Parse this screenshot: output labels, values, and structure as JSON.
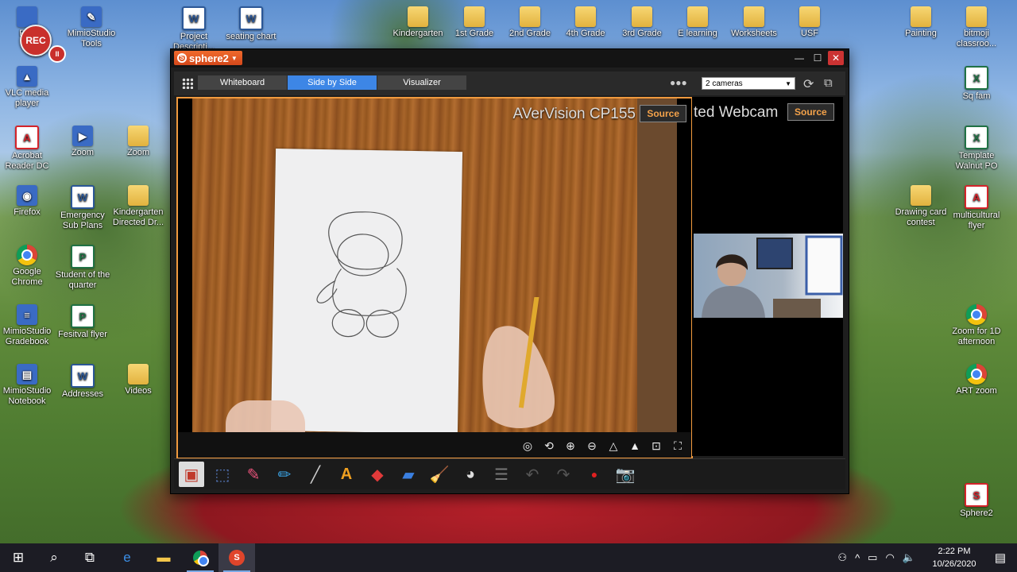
{
  "recorder": {
    "label": "REC"
  },
  "desktop_icons": [
    {
      "label": "Rec",
      "kind": "appbox",
      "glyph": ""
    },
    {
      "label": "MimioStudio Tools",
      "kind": "appbox",
      "glyph": "✎"
    },
    {
      "label": "Project Descripti...",
      "kind": "word",
      "glyph": "W"
    },
    {
      "label": "seating chart",
      "kind": "word",
      "glyph": "W"
    },
    {
      "label": "Kindergarten",
      "kind": "folder",
      "glyph": ""
    },
    {
      "label": "1st Grade",
      "kind": "folder",
      "glyph": ""
    },
    {
      "label": "2nd Grade",
      "kind": "folder",
      "glyph": ""
    },
    {
      "label": "4th Grade",
      "kind": "folder",
      "glyph": ""
    },
    {
      "label": "3rd Grade",
      "kind": "folder",
      "glyph": ""
    },
    {
      "label": "E learning",
      "kind": "folder",
      "glyph": ""
    },
    {
      "label": "Worksheets",
      "kind": "folder",
      "glyph": ""
    },
    {
      "label": "USF",
      "kind": "folder",
      "glyph": ""
    },
    {
      "label": "Painting",
      "kind": "folder",
      "glyph": ""
    },
    {
      "label": "bitmoji classroo...",
      "kind": "folder",
      "glyph": ""
    },
    {
      "label": "VLC media player",
      "kind": "appbox",
      "glyph": "▲"
    },
    {
      "label": "Sq fam",
      "kind": "excel",
      "glyph": "X"
    },
    {
      "label": "Acrobat Reader DC",
      "kind": "pdf",
      "glyph": "A"
    },
    {
      "label": "Zoom",
      "kind": "appbox",
      "glyph": "▶"
    },
    {
      "label": "Zoom",
      "kind": "folder",
      "glyph": ""
    },
    {
      "label": "Template Walnut PO",
      "kind": "excel",
      "glyph": "X"
    },
    {
      "label": "Firefox",
      "kind": "appbox",
      "glyph": "◉"
    },
    {
      "label": "Emergency Sub Plans",
      "kind": "word",
      "glyph": "W"
    },
    {
      "label": "Kindergarten Directed Dr...",
      "kind": "folder",
      "glyph": ""
    },
    {
      "label": "Drawing card contest",
      "kind": "folder",
      "glyph": ""
    },
    {
      "label": "multicultural flyer",
      "kind": "pdf",
      "glyph": "A"
    },
    {
      "label": "Google Chrome",
      "kind": "chrome",
      "glyph": ""
    },
    {
      "label": "Student of the quarter",
      "kind": "excel",
      "glyph": "P"
    },
    {
      "label": "MimioStudio Gradebook",
      "kind": "appbox",
      "glyph": "≡"
    },
    {
      "label": "Fesitval flyer",
      "kind": "excel",
      "glyph": "P"
    },
    {
      "label": "Zoom for 1D afternoon",
      "kind": "chrome",
      "glyph": ""
    },
    {
      "label": "MimioStudio Notebook",
      "kind": "appbox",
      "glyph": "▤"
    },
    {
      "label": "Addresses",
      "kind": "word",
      "glyph": "W"
    },
    {
      "label": "Videos",
      "kind": "folder",
      "glyph": ""
    },
    {
      "label": "ART zoom",
      "kind": "chrome",
      "glyph": ""
    },
    {
      "label": "Sphere2",
      "kind": "pdf",
      "glyph": "S"
    }
  ],
  "window": {
    "app_name": "sphere2",
    "tabs": [
      {
        "label": "Whiteboard",
        "active": false
      },
      {
        "label": "Side by Side",
        "active": true
      },
      {
        "label": "Visualizer",
        "active": false
      }
    ],
    "camera_select": "2 cameras",
    "camera1": {
      "label": "AVerVision CP155",
      "source_label": "Source"
    },
    "camera2": {
      "label": "ted Webcam",
      "source_label": "Source"
    }
  },
  "cam_tool_icons": [
    "focus-icon",
    "rotate-icon",
    "zoom-in-icon",
    "zoom-out-icon",
    "brightness-up-icon",
    "brightness-down-icon",
    "fit-icon",
    "fullscreen-icon"
  ],
  "bottom_tool_icons": [
    "select-area-icon",
    "pointer-icon",
    "pen-icon",
    "highlighter-icon",
    "line-icon",
    "text-icon",
    "shape-icon",
    "marker-icon",
    "eraser-icon",
    "palette-icon",
    "lines-icon",
    "undo-icon",
    "redo-icon",
    "record-icon",
    "camera-icon"
  ],
  "taskbar": {
    "clock_time": "2:22 PM",
    "clock_date": "10/26/2020"
  },
  "colors": {
    "accent_orange": "#f19a3e",
    "tab_active": "#3d86e6",
    "source_text": "#f4a24a",
    "rec_red": "#c9302c"
  }
}
